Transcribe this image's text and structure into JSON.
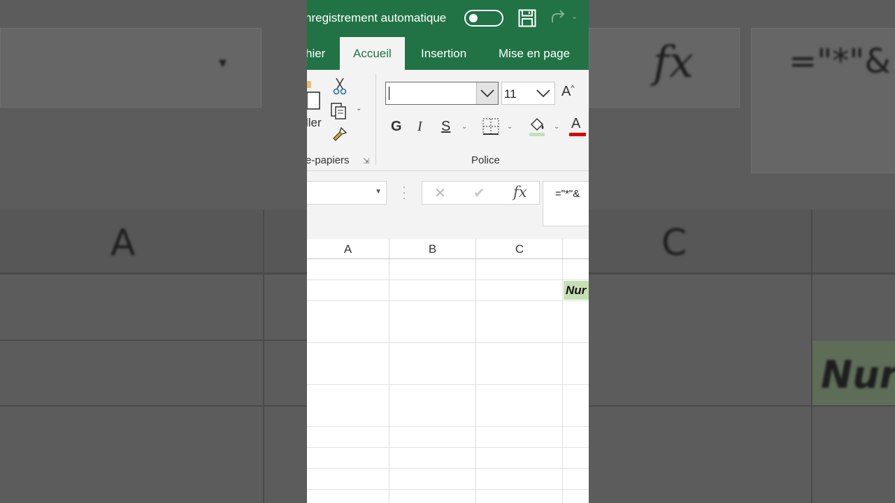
{
  "titlebar": {
    "autosave_label": "nregistrement automatique",
    "autosave_state": "off"
  },
  "tabs": [
    {
      "label": "hier",
      "active": false
    },
    {
      "label": "Accueil",
      "active": true
    },
    {
      "label": "Insertion",
      "active": false
    },
    {
      "label": "Mise en page",
      "active": false
    }
  ],
  "ribbon": {
    "clipboard": {
      "paste_label": "ller",
      "group_label": "e-papiers"
    },
    "font": {
      "font_name_value": "",
      "font_size_value": "11",
      "grow_font_label": "A",
      "bold_label": "G",
      "italic_label": "I",
      "underline_label": "S",
      "font_color_label": "A",
      "group_label": "Police"
    },
    "colors": {
      "fill": "#c6e0b4",
      "font_color": "#e00000"
    }
  },
  "formula_bar": {
    "name_box_value": "",
    "fx_label": "fx",
    "formula_text": "=\"*\"&"
  },
  "sheet": {
    "columns": [
      "A",
      "B",
      "C"
    ],
    "highlighted_cell_text": "Nur"
  },
  "backdrop": {
    "fx_label": "fx",
    "formula_text": "=\"*\"&",
    "col_a": "A",
    "col_c": "C",
    "cell_text": "Nur"
  },
  "accent": "#217346"
}
